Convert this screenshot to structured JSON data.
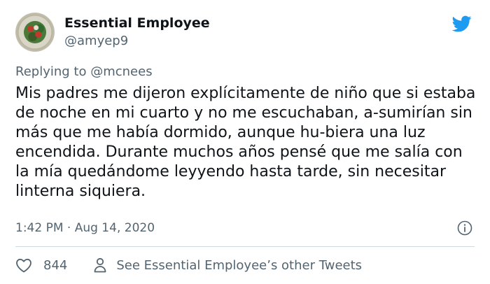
{
  "author": {
    "name": "Essential Employee",
    "handle": "@amyep9"
  },
  "reply": {
    "prefix": "Replying to ",
    "mention": "@mcnees"
  },
  "tweet": {
    "text": "Mis padres me dijeron explícitamente de niño que si estaba de noche en mi cuarto y no me escuchaban, a-sumirían sin más que me había dormido, aunque hu-biera una luz encendida. Durante muchos años pensé que me salía con la mía quedándome leyyendo hasta tarde, sin necesitar linterna siquiera."
  },
  "meta": {
    "timestamp": "1:42 PM · Aug 14, 2020"
  },
  "actions": {
    "like_count": "844",
    "other_tweets_label": "See Essential Employee’s other Tweets"
  },
  "colors": {
    "twitter_blue": "#1d9bf0",
    "secondary_text": "#536471"
  }
}
